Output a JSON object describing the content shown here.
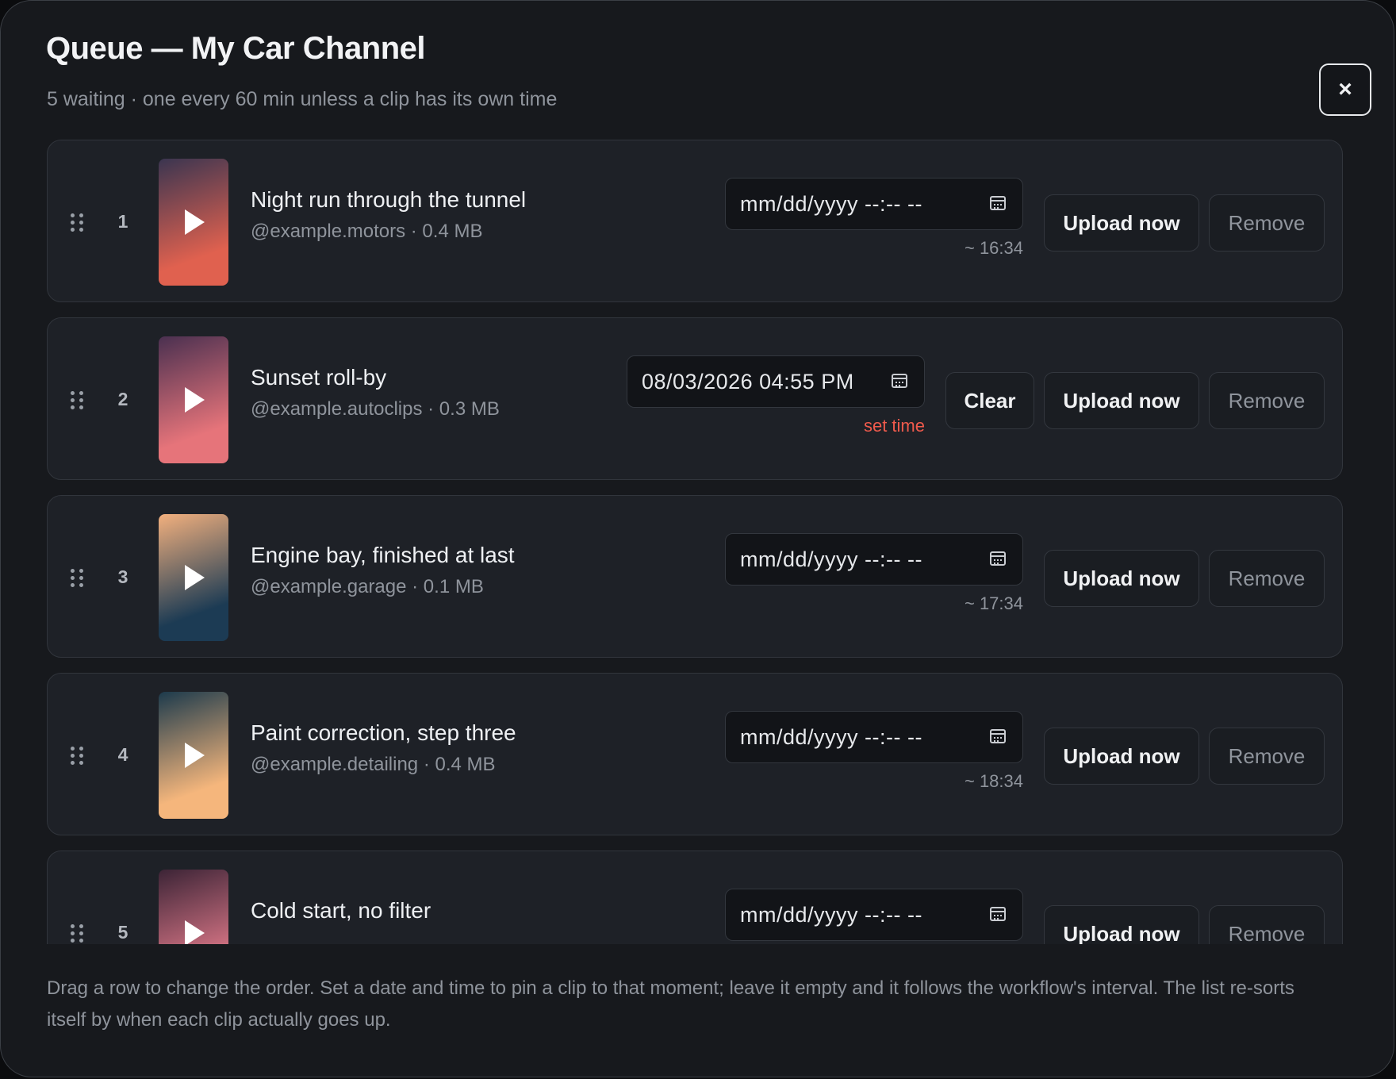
{
  "dialog": {
    "title": "Queue — My Car Channel",
    "subtitle": "5 waiting · one every 60 min unless a clip has its own time",
    "close_label": "×"
  },
  "labels": {
    "upload_now": "Upload now",
    "remove": "Remove",
    "clear": "Clear",
    "empty_datetime": "mm/dd/yyyy --:-- --"
  },
  "queue": [
    {
      "index": "1",
      "title": "Night run through the tunnel",
      "meta": "@example.motors · 0.4 MB",
      "datetime": "",
      "hint": "~ 16:34",
      "pinned": false,
      "thumb_colors": [
        "#3a3550",
        "#e0614f"
      ]
    },
    {
      "index": "2",
      "title": "Sunset roll-by",
      "meta": "@example.autoclips · 0.3 MB",
      "datetime": "08/03/2026 04:55 PM",
      "hint": "set time",
      "pinned": true,
      "thumb_colors": [
        "#4a3050",
        "#e6747a"
      ]
    },
    {
      "index": "3",
      "title": "Engine bay, finished at last",
      "meta": "@example.garage · 0.1 MB",
      "datetime": "",
      "hint": "~ 17:34",
      "pinned": false,
      "thumb_colors": [
        "#f2b07e",
        "#1c3b54"
      ]
    },
    {
      "index": "4",
      "title": "Paint correction, step three",
      "meta": "@example.detailing · 0.4 MB",
      "datetime": "",
      "hint": "~ 18:34",
      "pinned": false,
      "thumb_colors": [
        "#1c3a4c",
        "#f5b67c"
      ]
    },
    {
      "index": "5",
      "title": "Cold start, no filter",
      "meta": "",
      "datetime": "",
      "hint": "",
      "pinned": false,
      "thumb_colors": [
        "#3c2436",
        "#e07a8a"
      ]
    }
  ],
  "footer_note": "Drag a row to change the order. Set a date and time to pin a clip to that moment; leave it empty and it follows the workflow's interval. The list re-sorts itself by when each clip actually goes up."
}
